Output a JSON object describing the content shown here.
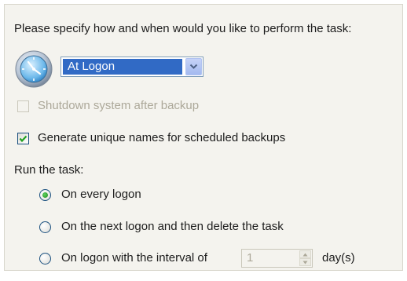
{
  "task_heading": "Please specify how and when would you like to perform the task:",
  "schedule": {
    "selected": "At Logon",
    "icon": "clock-icon"
  },
  "shutdown": {
    "label": "Shutdown system after backup",
    "checked": false,
    "enabled": false
  },
  "unique_names": {
    "label": "Generate unique names for scheduled backups",
    "checked": true
  },
  "run_task": {
    "label": "Run the task:",
    "options": [
      {
        "label": "On every logon",
        "selected": true
      },
      {
        "label": "On the next logon and then delete the task",
        "selected": false
      },
      {
        "label": "On logon with the interval of",
        "selected": false
      }
    ],
    "interval_value": "1",
    "interval_unit": "day(s)"
  },
  "colors": {
    "panel_background": "#f4f3ee",
    "selection_highlight": "#316ac5",
    "checkbox_border": "#1c5180",
    "check_mark": "#21a121",
    "disabled_text": "#aca899"
  }
}
